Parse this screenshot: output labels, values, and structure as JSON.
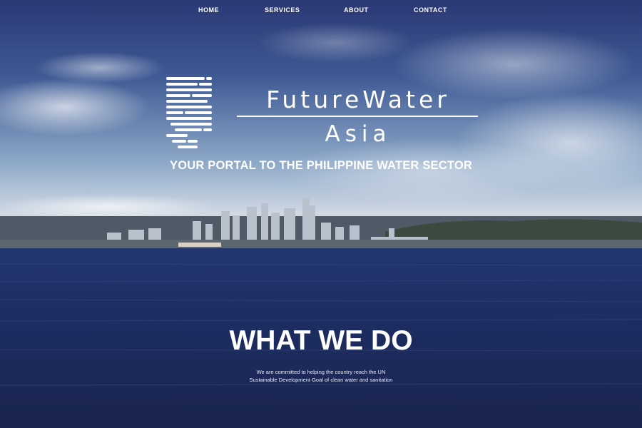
{
  "nav": {
    "items": [
      {
        "label": "HOME"
      },
      {
        "label": "SERVICES"
      },
      {
        "label": "ABOUT"
      },
      {
        "label": "CONTACT"
      }
    ]
  },
  "brand": {
    "line1": "FutureWater",
    "line2": "Asia",
    "logo_icon": "water-lines-icon"
  },
  "hero": {
    "tagline": "YOUR PORTAL TO THE PHILIPPINE WATER SECTOR"
  },
  "what_we_do": {
    "title": "WHAT WE DO",
    "body": "We are committed to helping the country reach the UN Sustainable Development Goal of clean water and sanitation"
  },
  "colors": {
    "sky_top": "#2c3f7a",
    "sky_light": "#d9e2ec",
    "sea": "#1e2f66",
    "text": "#ffffff"
  }
}
